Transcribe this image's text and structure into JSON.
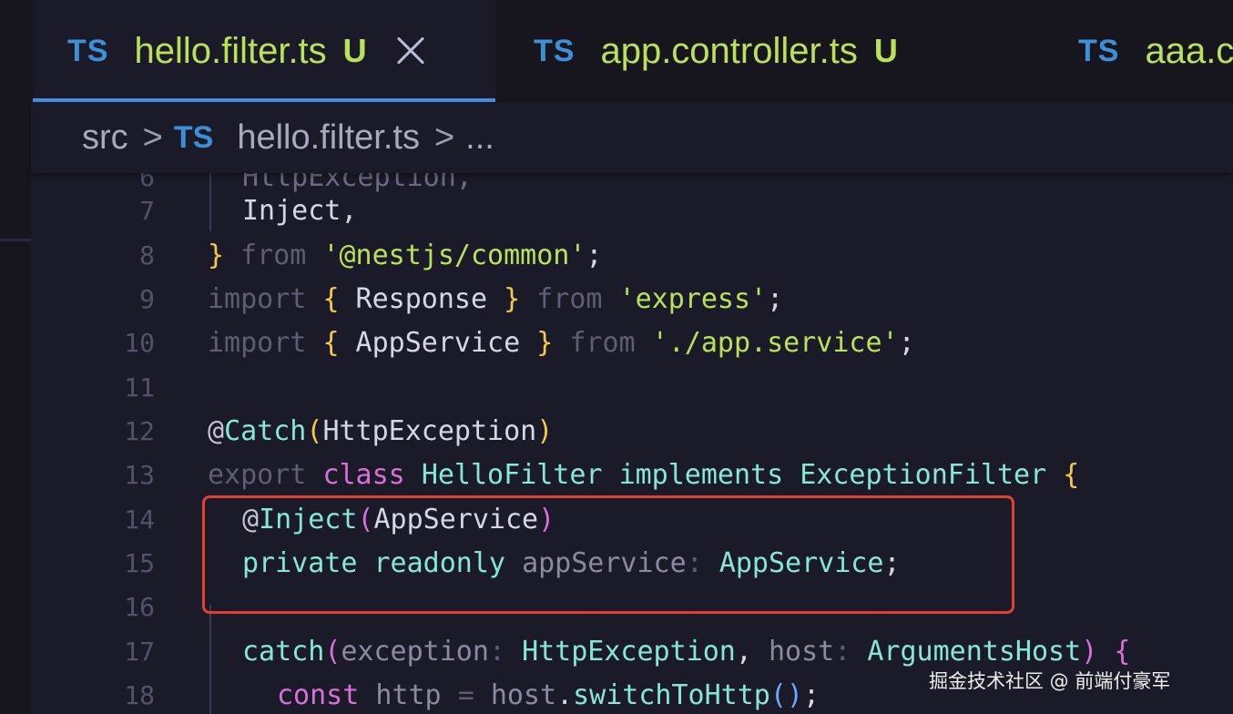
{
  "tabs": [
    {
      "lang": "TS",
      "name": "hello.filter.ts",
      "badge": "U",
      "active": true
    },
    {
      "lang": "TS",
      "name": "app.controller.ts",
      "badge": "U",
      "active": false
    },
    {
      "lang": "TS",
      "name": "aaa.c",
      "badge": "",
      "active": false
    }
  ],
  "breadcrumb": {
    "folder": "src",
    "sep": ">",
    "lang": "TS",
    "file": "hello.filter.ts",
    "more": "..."
  },
  "lines": [
    {
      "num": "6",
      "text": "HttpException,"
    },
    {
      "num": "7",
      "text": "Inject,"
    },
    {
      "num": "8",
      "text": "} from '@nestjs/common';"
    },
    {
      "num": "9",
      "text": "import { Response } from 'express';"
    },
    {
      "num": "10",
      "text": "import { AppService } from './app.service';"
    },
    {
      "num": "11",
      "text": ""
    },
    {
      "num": "12",
      "text": "@Catch(HttpException)"
    },
    {
      "num": "13",
      "text": "export class HelloFilter implements ExceptionFilter {"
    },
    {
      "num": "14",
      "text": "@Inject(AppService)"
    },
    {
      "num": "15",
      "text": "private readonly appService: AppService;"
    },
    {
      "num": "16",
      "text": ""
    },
    {
      "num": "17",
      "text": "catch(exception: HttpException, host: ArgumentsHost) {"
    },
    {
      "num": "18",
      "text": "const http = host.switchToHttp();"
    }
  ],
  "watermark": "掘金技术社区 @ 前端付豪军"
}
